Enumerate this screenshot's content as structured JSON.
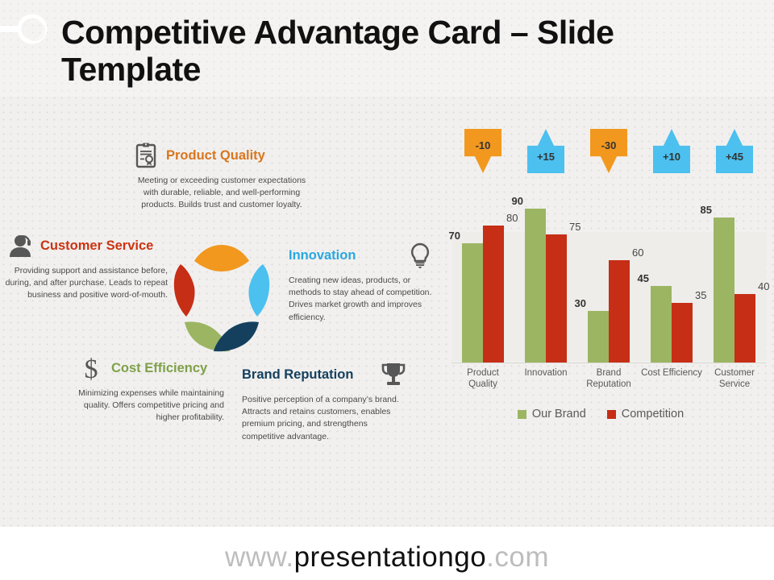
{
  "slide": {
    "title": "Competitive Advantage Card – Slide Template"
  },
  "cards": [
    {
      "key": "quality",
      "icon": "clipboard-quality-icon",
      "title": "Product Quality",
      "color": "#d9761f",
      "body": "Meeting or exceeding customer expectations with durable, reliable, and well-performing products. Builds trust and customer loyalty."
    },
    {
      "key": "service",
      "icon": "headset-support-icon",
      "title": "Customer Service",
      "color": "#cc3311",
      "body": "Providing support and assistance before, during, and after purchase. Leads to repeat business and positive word-of-mouth."
    },
    {
      "key": "innovation",
      "icon": "lightbulb-icon",
      "title": "Innovation",
      "color": "#29a8e0",
      "body": "Creating new ideas, products, or methods to stay ahead of competition. Drives market growth and improves efficiency."
    },
    {
      "key": "cost",
      "icon": "dollar-sign-icon",
      "title": "Cost Efficiency",
      "color": "#7fa14a",
      "body": "Minimizing expenses while maintaining quality. Offers competitive pricing and higher profitability."
    },
    {
      "key": "brand",
      "icon": "trophy-icon",
      "title": "Brand Reputation",
      "color": "#14405e",
      "body": "Positive perception of a company’s brand. Attracts and retains customers, enables premium pricing, and strengthens competitive advantage."
    }
  ],
  "pinwheel": {
    "petals": [
      {
        "name": "top",
        "color": "#f2981f"
      },
      {
        "name": "upper-left",
        "color": "#c62e16"
      },
      {
        "name": "upper-right",
        "color": "#4cc0ef"
      },
      {
        "name": "lower-left",
        "color": "#9cb563"
      },
      {
        "name": "lower-right",
        "color": "#14405e"
      }
    ]
  },
  "chart_data": {
    "type": "bar",
    "title": "",
    "xlabel": "",
    "ylabel": "",
    "ylim": [
      0,
      100
    ],
    "grid": false,
    "legend_position": "bottom",
    "categories": [
      "Product Quality",
      "Innovation",
      "Brand Reputation",
      "Cost Efficiency",
      "Customer Service"
    ],
    "series": [
      {
        "name": "Our Brand",
        "color": "#9cb563",
        "values": [
          70,
          90,
          30,
          45,
          85
        ]
      },
      {
        "name": "Competition",
        "color": "#c62e16",
        "values": [
          80,
          75,
          60,
          35,
          40
        ]
      }
    ],
    "deltas": [
      {
        "label": "-10",
        "direction": "down",
        "color": "#f2981f"
      },
      {
        "label": "+15",
        "direction": "up",
        "color": "#4cc0ef"
      },
      {
        "label": "-30",
        "direction": "down",
        "color": "#f2981f"
      },
      {
        "label": "+10",
        "direction": "up",
        "color": "#4cc0ef"
      },
      {
        "label": "+45",
        "direction": "up",
        "color": "#4cc0ef"
      }
    ]
  },
  "footer": {
    "prefix": "www.",
    "brand": "presentationgo",
    "suffix": ".com"
  }
}
